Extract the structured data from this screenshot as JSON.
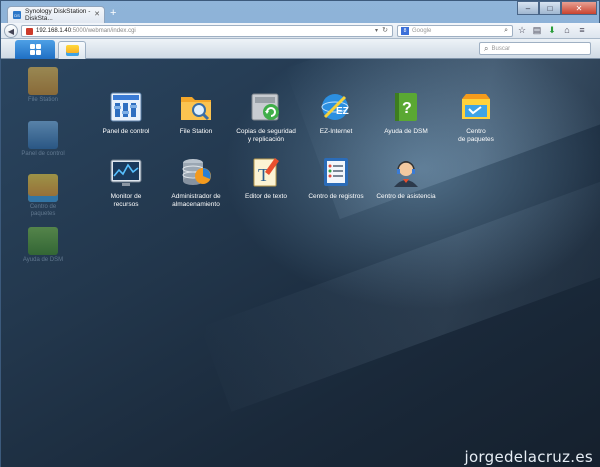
{
  "browser": {
    "tab_title": "Synology DiskStation - DiskSta...",
    "close_icon": "close-icon",
    "new_tab": "+",
    "url_host": "192.168.1.40",
    "url_path": ":5000/webman/index.cgi",
    "search_placeholder": "Google",
    "minimize": "–",
    "maximize": "□",
    "close": "✕"
  },
  "dsm": {
    "search_placeholder": "Buscar"
  },
  "desktop_shortcuts": [
    {
      "label": "File Station",
      "icon": "folder-icon"
    },
    {
      "label": "Panel de control",
      "icon": "control-panel-icon"
    },
    {
      "label": "Centro de paquetes",
      "icon": "package-center-icon"
    },
    {
      "label": "Ayuda de DSM",
      "icon": "help-book-icon"
    }
  ],
  "apps": [
    {
      "label": "Panel de control",
      "icon": "control-panel-icon"
    },
    {
      "label": "File Station",
      "icon": "folder-search-icon"
    },
    {
      "label": "Copias de seguridad\ny replicación",
      "icon": "backup-icon"
    },
    {
      "label": "EZ-Internet",
      "icon": "ez-internet-icon"
    },
    {
      "label": "Ayuda de DSM",
      "icon": "help-book-icon"
    },
    {
      "label": "Centro\nde paquetes",
      "icon": "package-center-icon"
    },
    {
      "label": "Monitor de\nrecursos",
      "icon": "resource-monitor-icon"
    },
    {
      "label": "Administrador de\nalmacenamiento",
      "icon": "storage-manager-icon"
    },
    {
      "label": "Editor de texto",
      "icon": "text-editor-icon"
    },
    {
      "label": "Centro de registros",
      "icon": "log-center-icon"
    },
    {
      "label": "Centro de asistencia",
      "icon": "support-center-icon"
    }
  ],
  "watermark": "jorgedelacruz.es"
}
